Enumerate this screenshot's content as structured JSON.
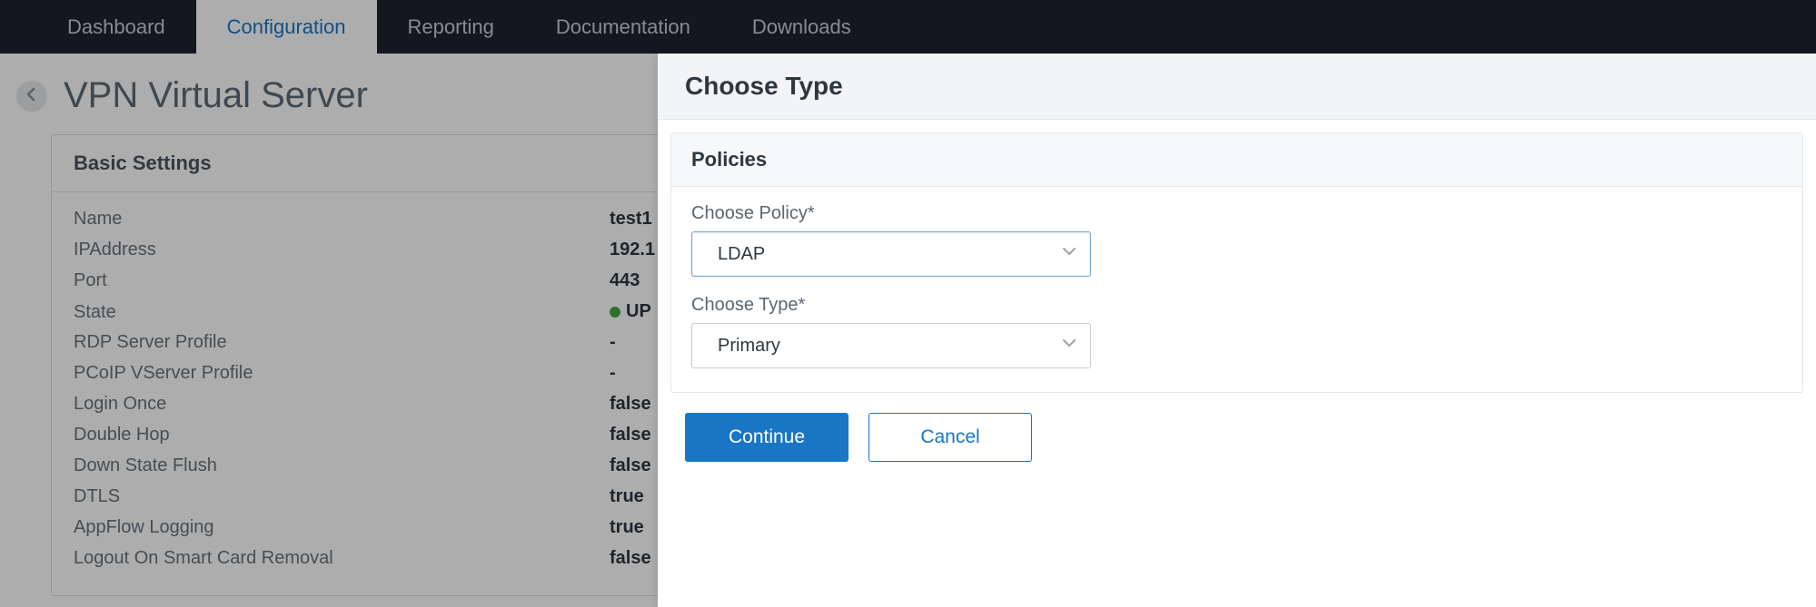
{
  "nav": {
    "items": [
      {
        "label": "Dashboard"
      },
      {
        "label": "Configuration"
      },
      {
        "label": "Reporting"
      },
      {
        "label": "Documentation"
      },
      {
        "label": "Downloads"
      }
    ],
    "active_index": 1
  },
  "page": {
    "title": "VPN Virtual Server"
  },
  "basic_settings": {
    "header": "Basic Settings",
    "rows": [
      {
        "label": "Name",
        "value": "test1"
      },
      {
        "label": "IPAddress",
        "value": "192.1"
      },
      {
        "label": "Port",
        "value": "443"
      },
      {
        "label": "State",
        "value": "UP",
        "status_dot": true
      },
      {
        "label": "RDP Server Profile",
        "value": "-"
      },
      {
        "label": "PCoIP VServer Profile",
        "value": "-"
      },
      {
        "label": "Login Once",
        "value": "false"
      },
      {
        "label": "Double Hop",
        "value": "false"
      },
      {
        "label": "Down State Flush",
        "value": "false"
      },
      {
        "label": "DTLS",
        "value": "true"
      },
      {
        "label": "AppFlow Logging",
        "value": "true"
      },
      {
        "label": "Logout On Smart Card Removal",
        "value": "false"
      }
    ]
  },
  "panel": {
    "title": "Choose Type",
    "policies_header": "Policies",
    "policy_label": "Choose Policy*",
    "policy_value": "LDAP",
    "type_label": "Choose Type*",
    "type_value": "Primary",
    "continue_label": "Continue",
    "cancel_label": "Cancel"
  }
}
